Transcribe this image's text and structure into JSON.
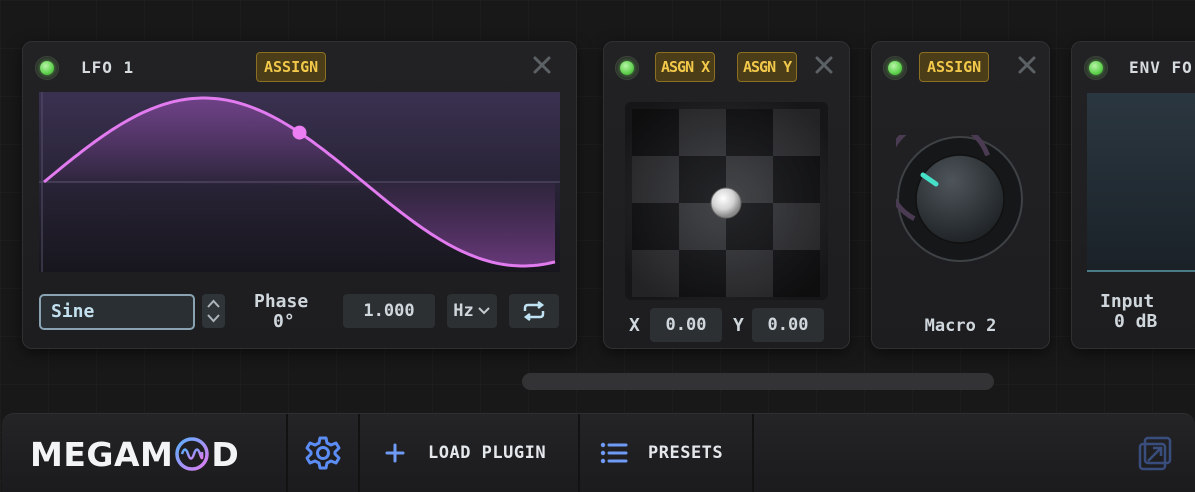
{
  "lfo": {
    "title": "LFO 1",
    "assign_label": "ASSIGN",
    "waveform_value": "Sine",
    "phase_label": "Phase",
    "phase_value": "0°",
    "rate_value": "1.000",
    "rate_unit": "Hz"
  },
  "xy_pad": {
    "assign_x_label": "ASGN X",
    "assign_y_label": "ASGN Y",
    "x_label": "X",
    "x_value": "0.00",
    "y_label": "Y",
    "y_value": "0.00"
  },
  "macro": {
    "assign_label": "ASSIGN",
    "title": "Macro 2"
  },
  "env": {
    "title": "ENV FO",
    "input_label": "Input",
    "input_value": "0 dB"
  },
  "bottom_bar": {
    "brand_prefix": "MEGAM",
    "brand_suffix": "D",
    "load_plugin_label": "LOAD PLUGIN",
    "presets_label": "PRESETS"
  },
  "colors": {
    "accent_purple": "#e27bf0",
    "power_green": "#5fd14d",
    "assign_gold": "#f2c84b",
    "macro_teal": "#46e0c8"
  },
  "icons": [
    "power-icon",
    "close-icon",
    "chevron-updown-icon",
    "chevron-down-icon",
    "loop-icon",
    "gear-icon",
    "plus-icon",
    "list-icon",
    "popout-icon"
  ]
}
